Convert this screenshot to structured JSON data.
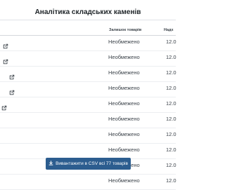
{
  "page": {
    "title": "Аналітика складських каменів"
  },
  "table": {
    "columns": {
      "stock": "Залишок товарів",
      "receipt": "Надх"
    },
    "rows": [
      {
        "stock": "Необмежено",
        "receipt": "12.0",
        "link_icon": "external-link-icon",
        "has_link": true
      },
      {
        "stock": "Необмежено",
        "receipt": "12.0",
        "link_icon": "external-link-icon",
        "has_link": true
      },
      {
        "stock": "Необмежено",
        "receipt": "12.0",
        "link_icon": "external-link-icon",
        "has_link": true
      },
      {
        "stock": "Необмежено",
        "receipt": "12.0",
        "link_icon": "external-link-icon",
        "has_link": true
      },
      {
        "stock": "Необмежено",
        "receipt": "12.0",
        "link_icon": "external-link-icon",
        "has_link": true
      },
      {
        "stock": "Необмежено",
        "receipt": "12.0",
        "has_link": false
      },
      {
        "stock": "Необмежено",
        "receipt": "12.0",
        "has_link": false
      },
      {
        "stock": "Необмежено",
        "receipt": "12.0",
        "has_link": false
      },
      {
        "stock": "Необмежено",
        "receipt": "12.0",
        "has_link": false
      },
      {
        "stock": "Необмежено",
        "receipt": "12.0",
        "has_link": false
      }
    ]
  },
  "export": {
    "label": "Вивантажити в CSV всі 77 товарів",
    "icon": "download-icon"
  },
  "colors": {
    "button_bg": "#2c5d8f",
    "text": "#1d2327",
    "muted": "#3c434a"
  }
}
